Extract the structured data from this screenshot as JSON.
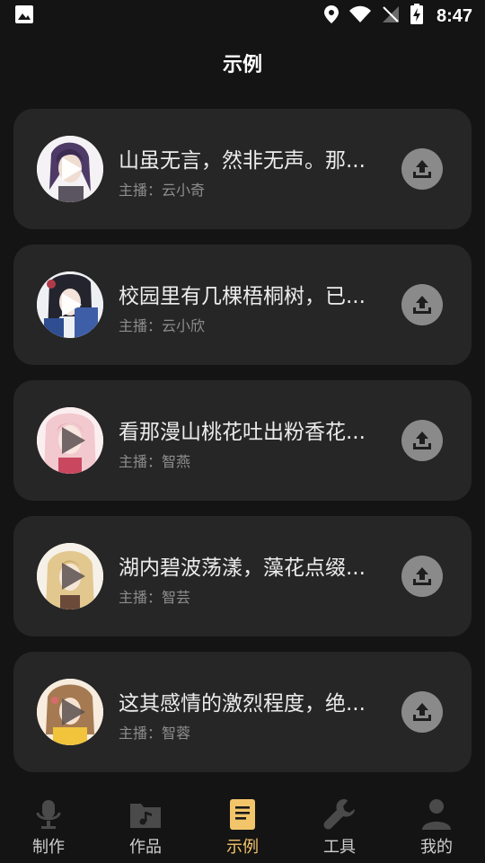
{
  "status_bar": {
    "time": "8:47"
  },
  "page": {
    "title": "示例"
  },
  "samples": [
    {
      "title": "山虽无言，然非无声。那...",
      "anchor": "主播：云小奇"
    },
    {
      "title": "校园里有几棵梧桐树，已...",
      "anchor": "主播：云小欣"
    },
    {
      "title": "看那漫山桃花吐出粉香花...",
      "anchor": "主播：智燕"
    },
    {
      "title": "湖内碧波荡漾，藻花点缀...",
      "anchor": "主播：智芸"
    },
    {
      "title": "这其感情的激烈程度，绝...",
      "anchor": "主播：智蓉"
    }
  ],
  "nav": {
    "items": [
      {
        "label": "制作",
        "icon": "microphone-icon"
      },
      {
        "label": "作品",
        "icon": "music-folder-icon"
      },
      {
        "label": "示例",
        "icon": "document-icon"
      },
      {
        "label": "工具",
        "icon": "wrench-icon"
      },
      {
        "label": "我的",
        "icon": "person-icon"
      }
    ],
    "active": "示例"
  },
  "colors": {
    "background": "#141414",
    "card": "#262626",
    "accent": "#f2c56a",
    "upload": "#8a8a8a"
  }
}
